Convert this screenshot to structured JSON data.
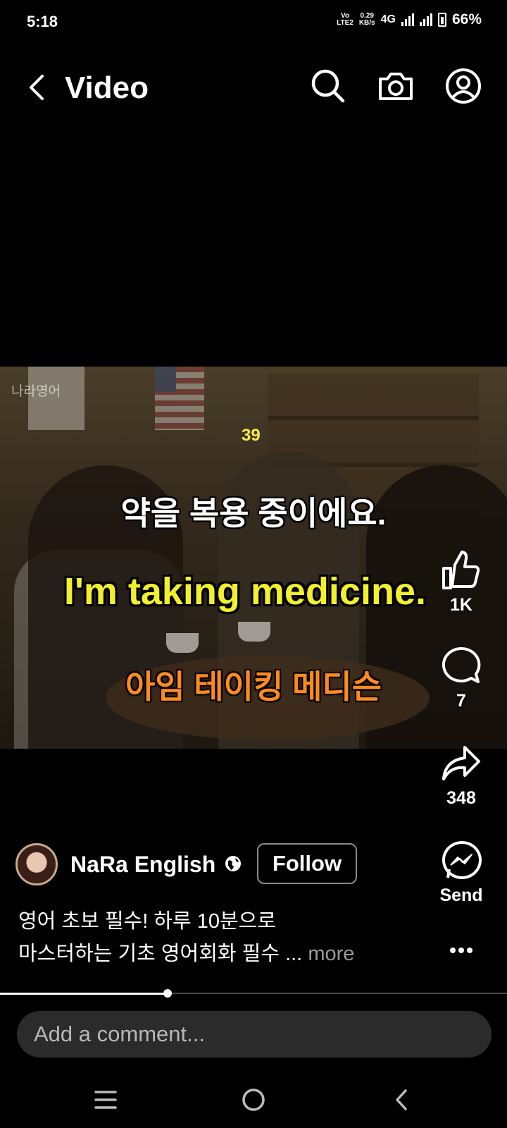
{
  "status_bar": {
    "time": "5:18",
    "volte": "Vo",
    "lte": "LTE2",
    "net_speed": "0.29",
    "net_unit": "KB/s",
    "network": "4G",
    "battery": "66%",
    "battery_level_pct": 66
  },
  "header": {
    "title": "Video",
    "icons": [
      "back-icon",
      "search-icon",
      "camera-icon",
      "profile-icon"
    ]
  },
  "video": {
    "watermark": "나라영어",
    "counter": "39",
    "caption_korean": "약을 복용 중이에요.",
    "caption_english": "I'm taking medicine.",
    "caption_pronunciation": "아임 테이킹 메디슨",
    "colors": {
      "english": "#f2f02c",
      "pronunciation": "#ff8a1f",
      "counter": "#f5ec4a"
    }
  },
  "actions": {
    "likes": "1K",
    "comments": "7",
    "shares": "348",
    "send_label": "Send",
    "icons": [
      "thumbs-up-icon",
      "comment-icon",
      "share-icon",
      "messenger-icon",
      "more-icon"
    ]
  },
  "author": {
    "name": "NaRa English",
    "follow_label": "Follow",
    "icon": "globe-icon"
  },
  "post": {
    "caption_line1": "영어 초보 필수! 하루 10분으로",
    "caption_line2": "마스터하는 기초 영어회화 필수 ...",
    "more_label": "more"
  },
  "playback": {
    "progress_fraction": 0.33
  },
  "comment": {
    "placeholder": "Add a comment..."
  },
  "nav": {
    "icons": [
      "recents-icon",
      "home-icon",
      "back-nav-icon"
    ]
  }
}
